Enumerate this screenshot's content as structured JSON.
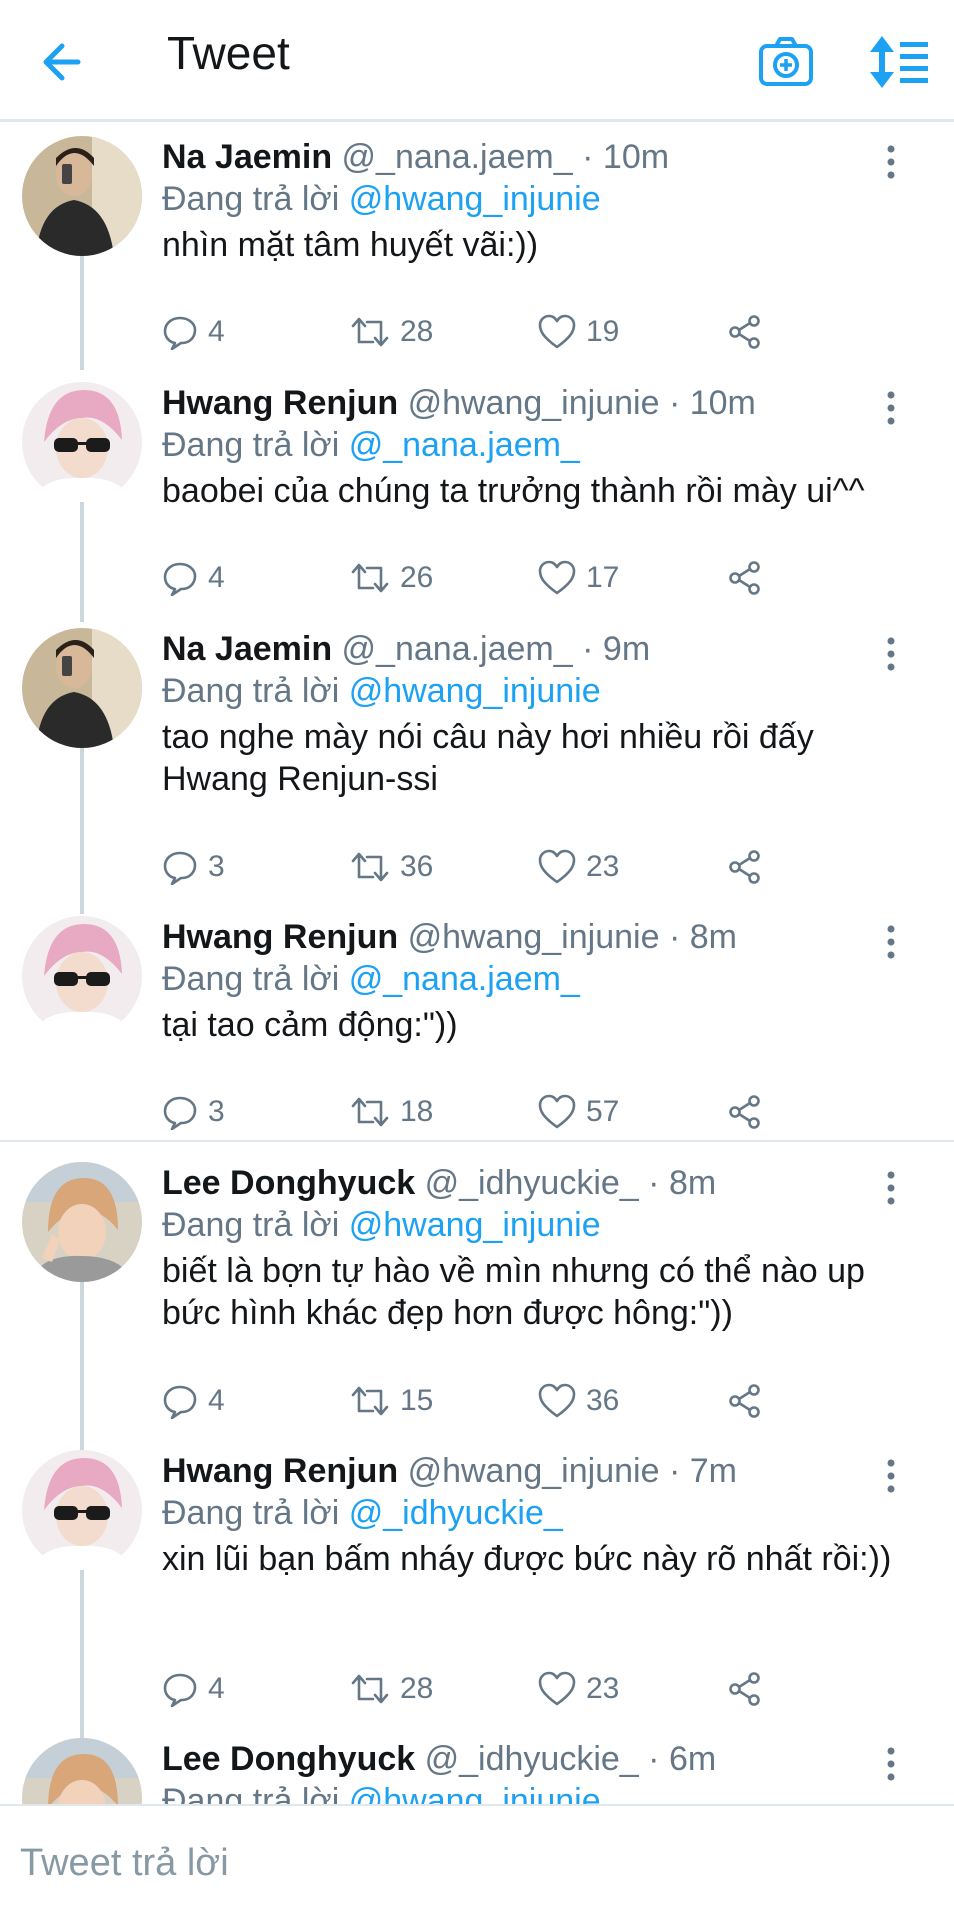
{
  "header": {
    "title": "Tweet"
  },
  "colors": {
    "accent": "#1da1f2",
    "muted": "#657786",
    "text": "#14171a"
  },
  "tweets": [
    {
      "name": "Na Jaemin",
      "handle": "@_nana.jaem_",
      "dot": "·",
      "time": "10m",
      "reply_prefix": "Đang trả lời",
      "reply_to": "@hwang_injunie",
      "text": "nhìn mặt tâm huyết vãi:))",
      "replies": "4",
      "retweets": "28",
      "likes": "19",
      "avatar": "man-mirror-selfie"
    },
    {
      "name": "Hwang Renjun",
      "handle": "@hwang_injunie",
      "dot": "·",
      "time": "10m",
      "reply_prefix": "Đang trả lời",
      "reply_to": "@_nana.jaem_",
      "text": "baobei của chúng ta trưởng thành rồi mày ui^^",
      "replies": "4",
      "retweets": "26",
      "likes": "17",
      "avatar": "pink-hair-sunglasses"
    },
    {
      "name": "Na Jaemin",
      "handle": "@_nana.jaem_",
      "dot": "·",
      "time": "9m",
      "reply_prefix": "Đang trả lời",
      "reply_to": "@hwang_injunie",
      "text": "tao nghe mày nói câu này hơi nhiều rồi đấy Hwang Renjun-ssi",
      "replies": "3",
      "retweets": "36",
      "likes": "23",
      "avatar": "man-mirror-selfie"
    },
    {
      "name": "Hwang Renjun",
      "handle": "@hwang_injunie",
      "dot": "·",
      "time": "8m",
      "reply_prefix": "Đang trả lời",
      "reply_to": "@_nana.jaem_",
      "text": "tại tao cảm động:\"))",
      "replies": "3",
      "retweets": "18",
      "likes": "57",
      "avatar": "pink-hair-sunglasses"
    },
    {
      "name": "Lee Donghyuck",
      "handle": "@_idhyuckie_",
      "dot": "·",
      "time": "8m",
      "reply_prefix": "Đang trả lời",
      "reply_to": "@hwang_injunie",
      "text": "biết là bợn tự hào về mìn nhưng có thể nào up bức hình khác đẹp hơn được hông:\"))",
      "replies": "4",
      "retweets": "15",
      "likes": "36",
      "avatar": "beach-selfie"
    },
    {
      "name": "Hwang Renjun",
      "handle": "@hwang_injunie",
      "dot": "·",
      "time": "7m",
      "reply_prefix": "Đang trả lời",
      "reply_to": "@_idhyuckie_",
      "text": "xin lũi bạn bấm nháy được bức này rõ nhất rồi:))",
      "replies": "4",
      "retweets": "28",
      "likes": "23",
      "avatar": "pink-hair-sunglasses"
    },
    {
      "name": "Lee Donghyuck",
      "handle": "@_idhyuckie_",
      "dot": "·",
      "time": "6m",
      "reply_prefix": "Đang trả lời",
      "reply_to": "@hwang_injunie",
      "text": "",
      "replies": "",
      "retweets": "",
      "likes": "",
      "avatar": "beach-selfie"
    }
  ],
  "composer": {
    "placeholder": "Tweet trả lời"
  }
}
